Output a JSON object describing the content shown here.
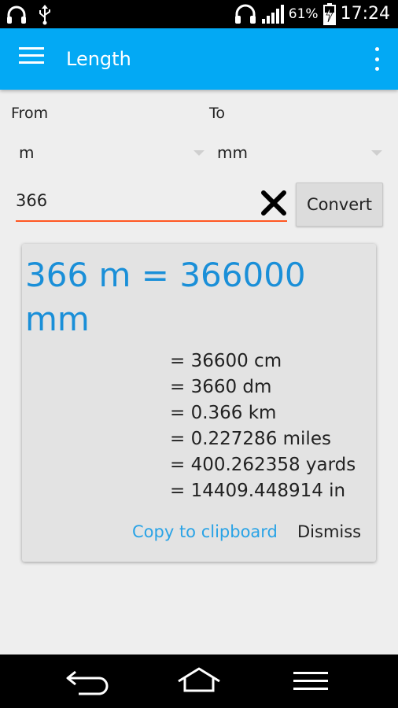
{
  "status_bar": {
    "battery_percent": "61%",
    "time": "17:24",
    "icons": [
      "headphones-icon",
      "usb-icon",
      "headset-icon",
      "signal-icon",
      "battery-charging-icon"
    ]
  },
  "app_bar": {
    "title": "Length",
    "icons": [
      "menu-icon",
      "overflow-icon"
    ]
  },
  "form": {
    "from_label": "From",
    "to_label": "To",
    "from_unit": "m",
    "to_unit": "mm",
    "input_value": "366",
    "convert_label": "Convert"
  },
  "result_card": {
    "main_result": "366 m = 366000 mm",
    "conversions": [
      "= 36600 cm",
      "= 3660 dm",
      "= 0.366 km",
      "= 0.227286 miles",
      "= 400.262358 yards",
      "= 14409.448914 in"
    ],
    "copy_label": "Copy to clipboard",
    "dismiss_label": "Dismiss"
  },
  "colors": {
    "app_bar": "#03a9f4",
    "accent_text": "#1a8fd8",
    "input_underline": "#ff5722"
  },
  "nav_bar": {
    "icons": [
      "back-icon",
      "home-icon",
      "menu-lines-icon"
    ]
  }
}
